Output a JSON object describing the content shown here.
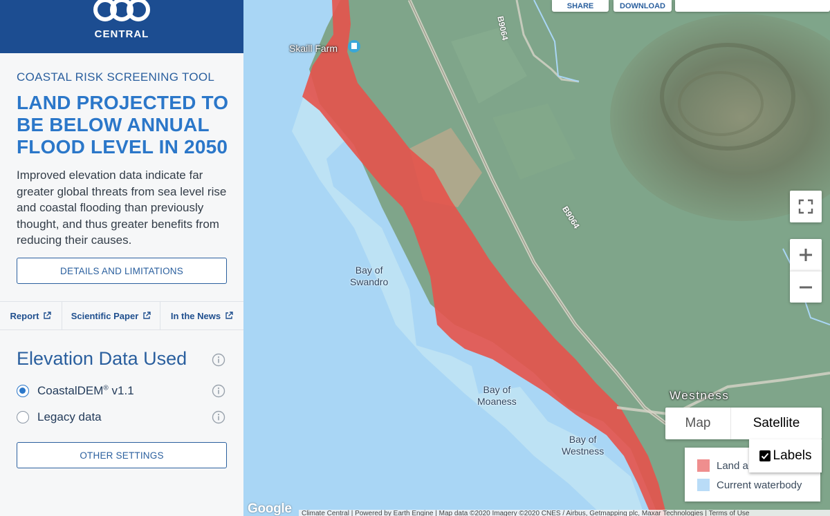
{
  "brand": {
    "logo_text": "CENTRAL"
  },
  "sidebar": {
    "tool_label": "COASTAL RISK SCREENING TOOL",
    "title": "LAND PROJECTED TO BE BELOW ANNUAL FLOOD LEVEL IN 2050",
    "intro": "Improved elevation data indicate far greater global threats from sea level rise and coastal flooding than previously thought, and thus greater benefits from reducing their causes.",
    "details_button": "DETAILS AND LIMITATIONS",
    "links": [
      {
        "label": "Report"
      },
      {
        "label": "Scientific Paper"
      },
      {
        "label": "In the News"
      }
    ],
    "elevation_title": "Elevation Data Used",
    "options": [
      {
        "label": "CoastalDEM",
        "mark": "®",
        "version": " v1.1",
        "selected": true
      },
      {
        "label": "Legacy data",
        "selected": false
      }
    ],
    "settings_button": "OTHER SETTINGS"
  },
  "map": {
    "top_buttons": {
      "share": "SHARE",
      "download": "DOWNLOAD"
    },
    "labels": {
      "skaill": "Skaill Farm",
      "swandro": "Bay of\nSwandro",
      "moaness": "Bay of\nMoaness",
      "westness_bay": "Bay of\nWestness",
      "westness": "Westness",
      "road_top": "B9064",
      "road_mid": "B9064"
    },
    "map_type": {
      "map": "Map",
      "satellite": "Satellite",
      "labels": "Labels"
    },
    "legend": {
      "land": "Land a",
      "water": "Current waterbody"
    },
    "google": "Google",
    "attribution": "Climate Central  |  Powered by Earth Engine   |   Map data ©2020 Imagery ©2020 CNES / Airbus, Getmapping plc, Maxar Technologies   |   Terms of Use",
    "colors": {
      "sea": "#a9d6f5",
      "flood": "#e5534b",
      "land": "#7fa58a",
      "legend_land": "#ef8e8e",
      "legend_water": "#b9dcf7"
    }
  }
}
